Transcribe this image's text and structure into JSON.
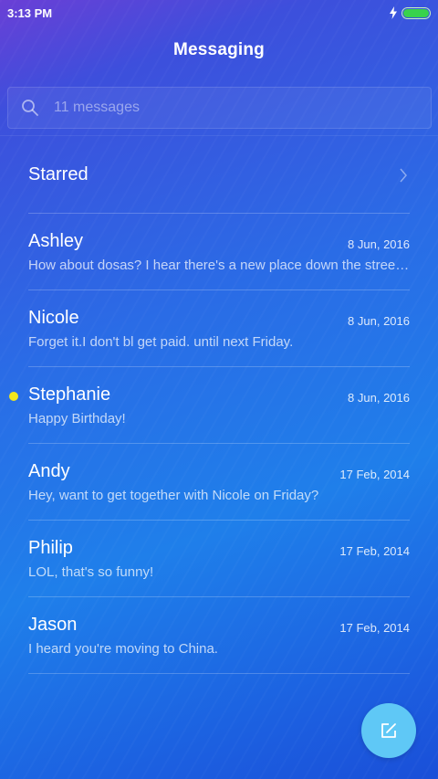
{
  "status_bar": {
    "time": "3:13 PM"
  },
  "header": {
    "title": "Messaging"
  },
  "search": {
    "placeholder": "11 messages"
  },
  "starred": {
    "label": "Starred"
  },
  "conversations": [
    {
      "name": "Ashley",
      "date": "8 Jun, 2016",
      "preview": "How about dosas? I hear there's a new place down the street...",
      "unread": false
    },
    {
      "name": "Nicole",
      "date": "8 Jun, 2016",
      "preview": "Forget it.I don't bl get paid. until next Friday.",
      "unread": false
    },
    {
      "name": "Stephanie",
      "date": "8 Jun, 2016",
      "preview": "Happy Birthday!",
      "unread": true
    },
    {
      "name": "Andy",
      "date": "17 Feb, 2014",
      "preview": "Hey, want to get together with Nicole on Friday?",
      "unread": false
    },
    {
      "name": "Philip",
      "date": "17 Feb, 2014",
      "preview": "LOL, that's so funny!",
      "unread": false
    },
    {
      "name": "Jason",
      "date": "17 Feb, 2014",
      "preview": "I heard you're moving to China.",
      "unread": false
    }
  ],
  "colors": {
    "unread_dot": "#f2e81c",
    "fab": "#5fc8f6",
    "battery": "#38d24c"
  },
  "icons": {
    "search": "search-icon",
    "starred_chevron": "chevron-right-icon",
    "fab": "compose-icon",
    "charging": "bolt-icon",
    "battery": "battery-icon"
  }
}
